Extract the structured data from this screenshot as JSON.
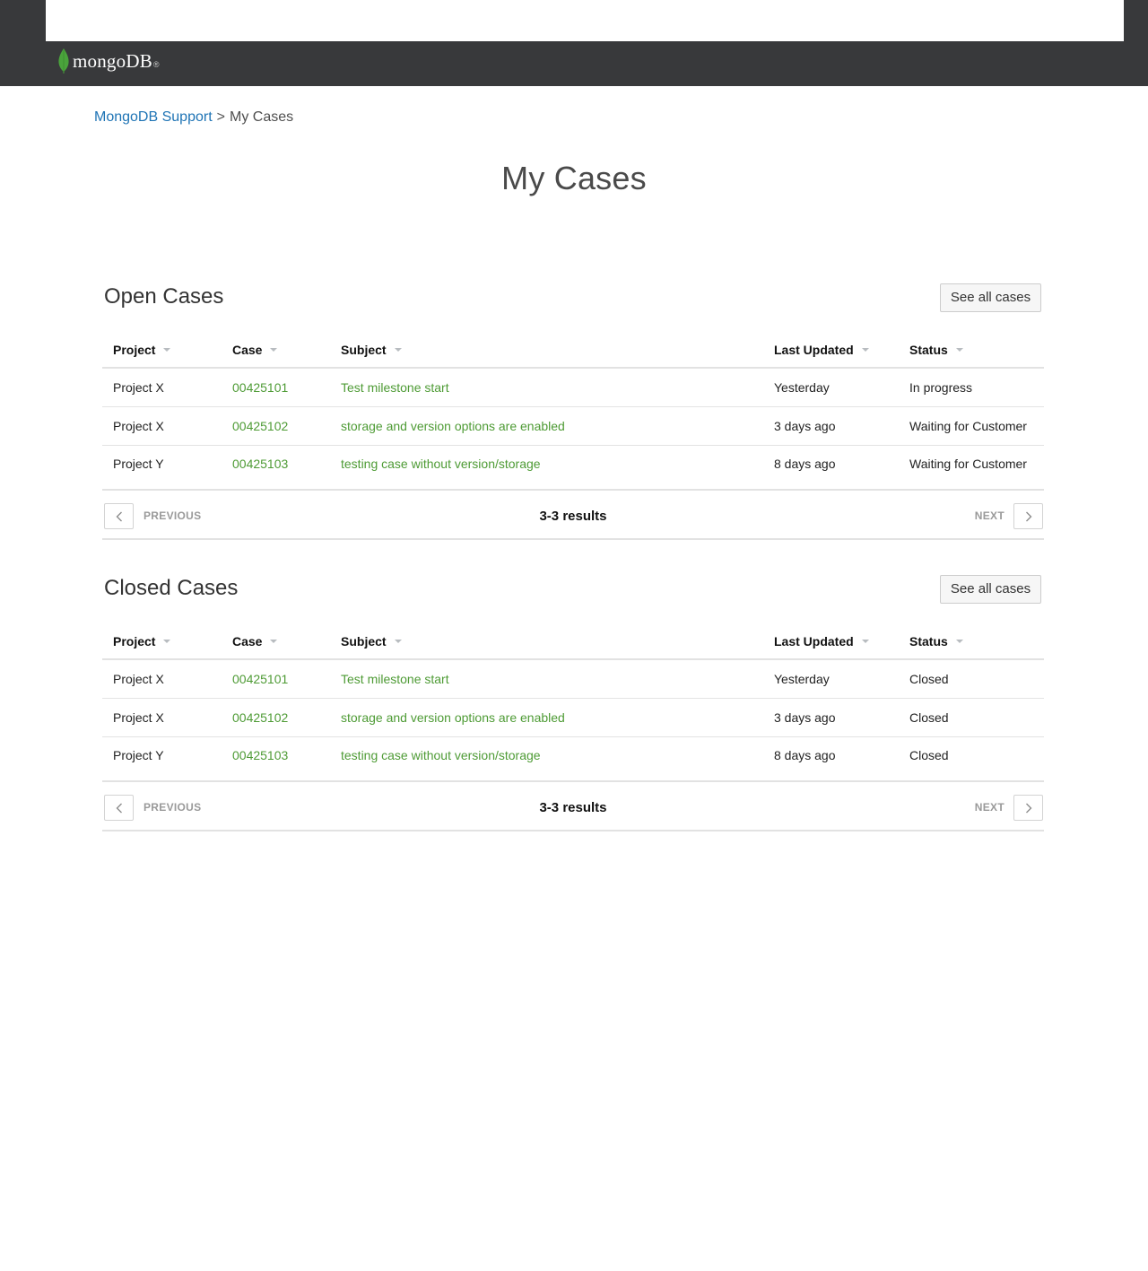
{
  "brand": {
    "logo_text": "mongoDB",
    "logo_reg": "®",
    "leaf_color": "#4aa33c"
  },
  "breadcrumb": {
    "home": "MongoDB Support",
    "separator": ">",
    "current": "My Cases"
  },
  "page_title": "My Cases",
  "colors": {
    "link_green": "#4e9b35",
    "link_blue": "#1f74b5",
    "navbar": "#38393b"
  },
  "open_cases": {
    "title": "Open Cases",
    "see_all": "See all cases",
    "columns": {
      "project": "Project",
      "case": "Case",
      "subject": "Subject",
      "last_updated": "Last Updated",
      "status": "Status"
    },
    "rows": [
      {
        "project": "Project X",
        "case": "00425101",
        "subject": "Test milestone start",
        "last_updated": "Yesterday",
        "status": "In progress"
      },
      {
        "project": "Project X",
        "case": "00425102",
        "subject": "storage and version options are enabled",
        "last_updated": "3 days ago",
        "status": "Waiting for Customer"
      },
      {
        "project": "Project Y",
        "case": "00425103",
        "subject": "testing case without version/storage",
        "last_updated": "8 days ago",
        "status": "Waiting for Customer"
      }
    ],
    "pager": {
      "previous": "PREVIOUS",
      "next": "NEXT",
      "results": "3-3 results"
    }
  },
  "closed_cases": {
    "title": "Closed Cases",
    "see_all": "See all cases",
    "columns": {
      "project": "Project",
      "case": "Case",
      "subject": "Subject",
      "last_updated": "Last Updated",
      "status": "Status"
    },
    "rows": [
      {
        "project": "Project X",
        "case": "00425101",
        "subject": "Test milestone start",
        "last_updated": "Yesterday",
        "status": "Closed"
      },
      {
        "project": "Project X",
        "case": "00425102",
        "subject": "storage and version options are enabled",
        "last_updated": "3 days ago",
        "status": "Closed"
      },
      {
        "project": "Project Y",
        "case": "00425103",
        "subject": "testing case without version/storage",
        "last_updated": "8 days ago",
        "status": "Closed"
      }
    ],
    "pager": {
      "previous": "PREVIOUS",
      "next": "NEXT",
      "results": "3-3 results"
    }
  }
}
